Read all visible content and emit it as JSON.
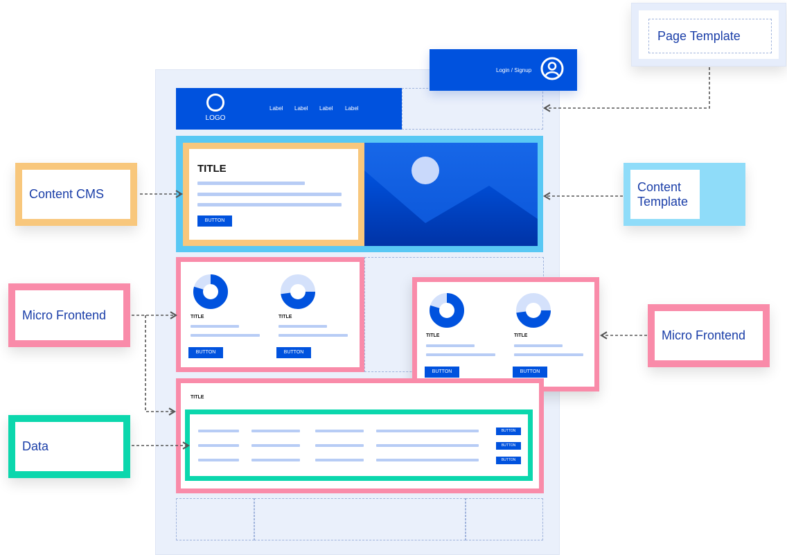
{
  "header": {
    "logo_text": "LOGO",
    "nav": [
      "Label",
      "Label",
      "Label",
      "Label"
    ],
    "login_text": "Login / Signup"
  },
  "hero": {
    "title": "TITLE",
    "button": "BUTTON"
  },
  "micro_frontend_left": {
    "cards": [
      {
        "title": "TITLE",
        "button": "BUTTON"
      },
      {
        "title": "TITLE",
        "button": "BUTTON"
      }
    ]
  },
  "micro_frontend_right": {
    "cards": [
      {
        "title": "TITLE",
        "button": "BUTTON"
      },
      {
        "title": "TITLE",
        "button": "BUTTON"
      }
    ]
  },
  "data_section": {
    "title": "TITLE",
    "row_buttons": [
      "BUTTON",
      "BUTTON",
      "BUTTON"
    ]
  },
  "callouts": {
    "page_template": "Page Template",
    "content_cms": "Content CMS",
    "content_template": "Content Template",
    "micro_frontend_left": "Micro Frontend",
    "micro_frontend_right": "Micro Frontend",
    "data": "Data"
  },
  "colors": {
    "brand_blue": "#0052de",
    "cms_orange": "#f8c77c",
    "template_cyan": "#59c8f4",
    "micro_frontend_pink": "#f98ba9",
    "data_green": "#0bd7ad",
    "placeholder_line": "#b7ccf5"
  }
}
